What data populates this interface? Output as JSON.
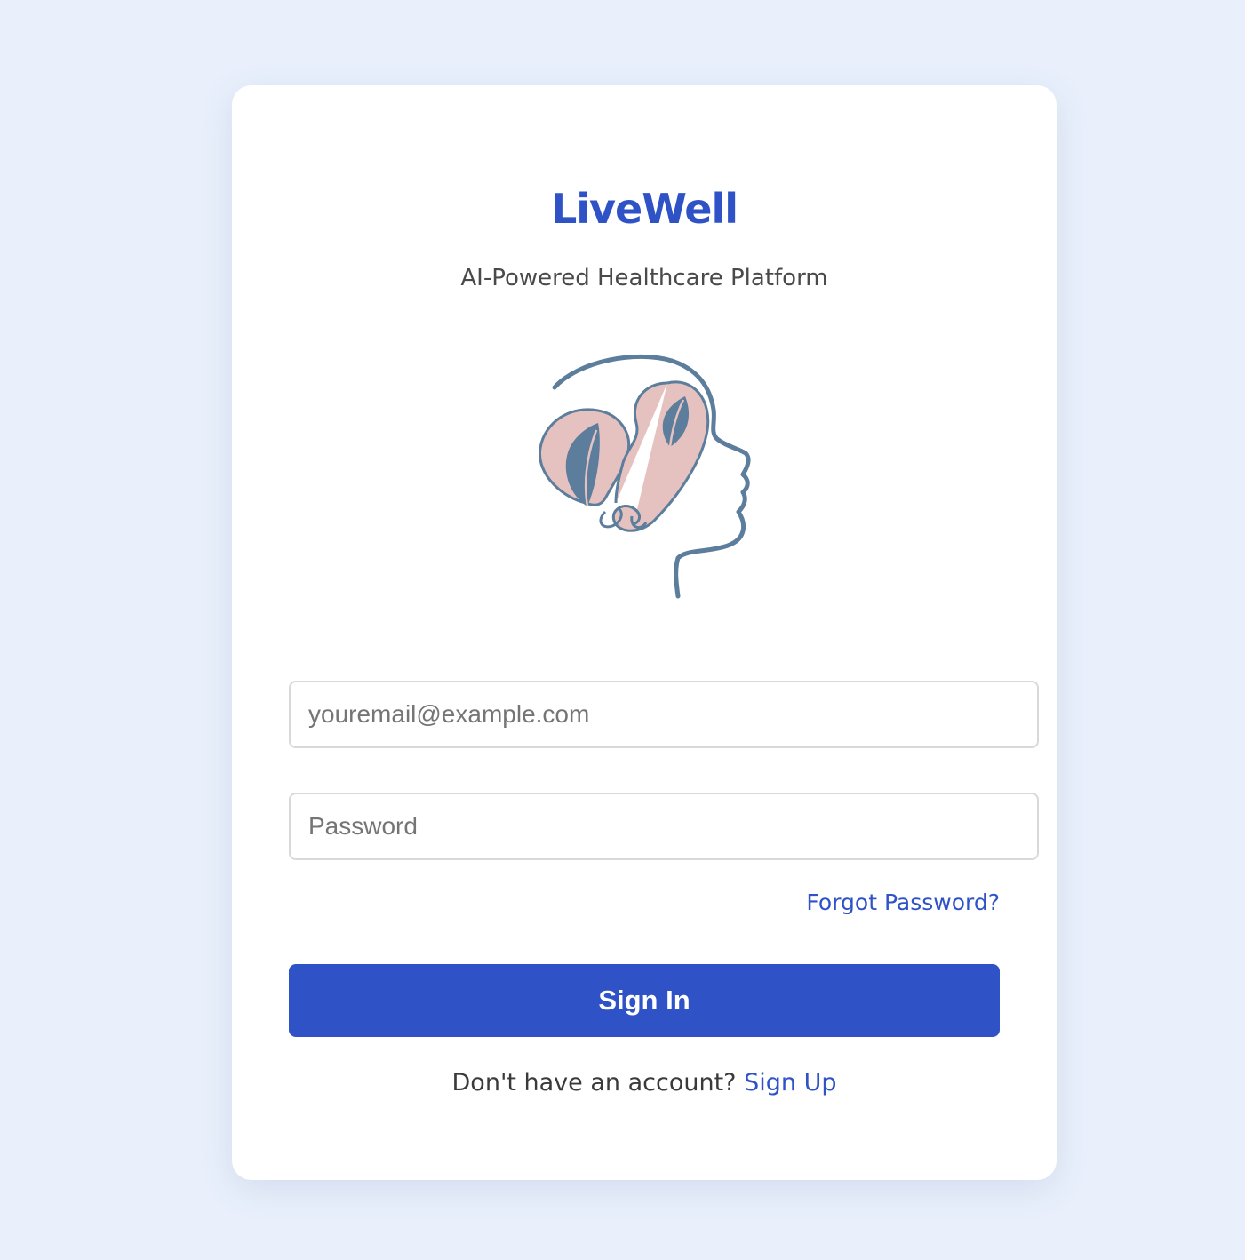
{
  "brand": {
    "title": "LiveWell",
    "subtitle": "AI-Powered Healthcare Platform",
    "logo_icon": "head-lungs-leaves-logo",
    "colors": {
      "accent": "#2f53c7",
      "logo_stroke": "#5c7d9b",
      "logo_fill": "#e5c2c0",
      "background": "#e9f0fc"
    }
  },
  "form": {
    "email_placeholder": "youremail@example.com",
    "email_value": "",
    "password_placeholder": "Password",
    "password_value": "",
    "forgot_label": "Forgot Password?",
    "submit_label": "Sign In",
    "signup_prompt": "Don't have an account?",
    "signup_label": "Sign Up"
  }
}
